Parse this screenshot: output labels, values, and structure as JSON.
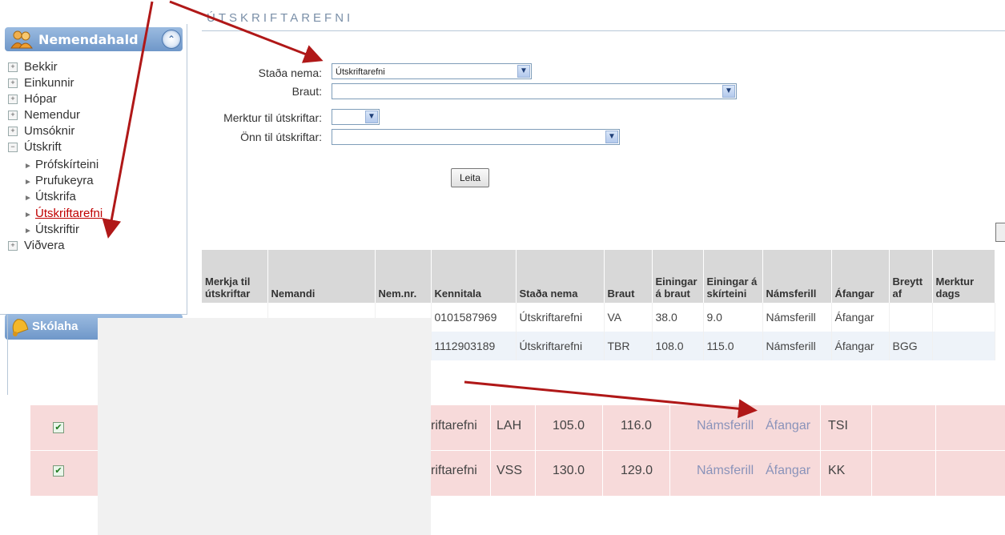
{
  "sidebar": {
    "panel_title": "Nemendahald",
    "items": [
      {
        "label": "Bekkir",
        "expander": "+"
      },
      {
        "label": "Einkunnir",
        "expander": "+"
      },
      {
        "label": "Hópar",
        "expander": "+"
      },
      {
        "label": "Nemendur",
        "expander": "+"
      },
      {
        "label": "Umsóknir",
        "expander": "+"
      },
      {
        "label": "Útskrift",
        "expander": "−"
      }
    ],
    "sub_items": [
      {
        "label": "Prófskírteini"
      },
      {
        "label": "Prufukeyra"
      },
      {
        "label": "Útskrifa"
      },
      {
        "label": "Útskriftarefni"
      },
      {
        "label": "Útskriftir"
      }
    ],
    "last_item": {
      "label": "Viðvera",
      "expander": "+"
    },
    "panel2_title": "Skólaha"
  },
  "main": {
    "heading": "ÚTSKRIFTAREFNI",
    "form": {
      "stada_label": "Staða nema:",
      "stada_value": "Útskriftarefni",
      "braut_label": "Braut:",
      "braut_value": "",
      "merktur_label": "Merktur til útskriftar:",
      "merktur_value": "",
      "onn_label": "Önn til útskriftar:",
      "onn_value": ""
    },
    "search_button": "Leita",
    "table": {
      "headers": [
        "Merkja til útskriftar",
        "Nemandi",
        "Nem.nr.",
        "Kennitala",
        "Staða nema",
        "Braut",
        "Einingar á braut",
        "Einingar á skírteini",
        "Námsferill",
        "Áfangar",
        "Breytt af",
        "Merktur dags"
      ],
      "rows": [
        {
          "kennitala": "0101587969",
          "stada": "Útskriftarefni",
          "braut": "VA",
          "ein_braut": "38.0",
          "ein_skirt": "9.0",
          "namsferill": "Námsferill",
          "afangar": "Áfangar",
          "breytt": ""
        },
        {
          "kennitala": "1112903189",
          "stada": "Útskriftarefni",
          "braut": "TBR",
          "ein_braut": "108.0",
          "ein_skirt": "115.0",
          "namsferill": "Námsferill",
          "afangar": "Áfangar",
          "breytt": "BGG"
        }
      ]
    },
    "zoom_rows": [
      {
        "checked": "✔",
        "stada": "riftarefni",
        "braut": "LAH",
        "ein_braut": "105.0",
        "ein_skirt": "116.0",
        "namsferill": "Námsferill",
        "afangar": "Áfangar",
        "breytt": "TSI"
      },
      {
        "checked": "✔",
        "stada": "riftarefni",
        "braut": "VSS",
        "ein_braut": "130.0",
        "ein_skirt": "129.0",
        "namsferill": "Námsferill",
        "afangar": "Áfangar",
        "breytt": "KK"
      }
    ]
  },
  "colors": {
    "arrow": "#b01818",
    "highlight_row": "#f7dada",
    "header_bg": "#d8d8d8",
    "sidebar_header": "#6f97c9"
  },
  "icons": {
    "panel1": "people-icon",
    "panel2": "bell-icon",
    "collapse": "chevron-up-circle-icon",
    "dropdown": "chevron-down-icon"
  }
}
